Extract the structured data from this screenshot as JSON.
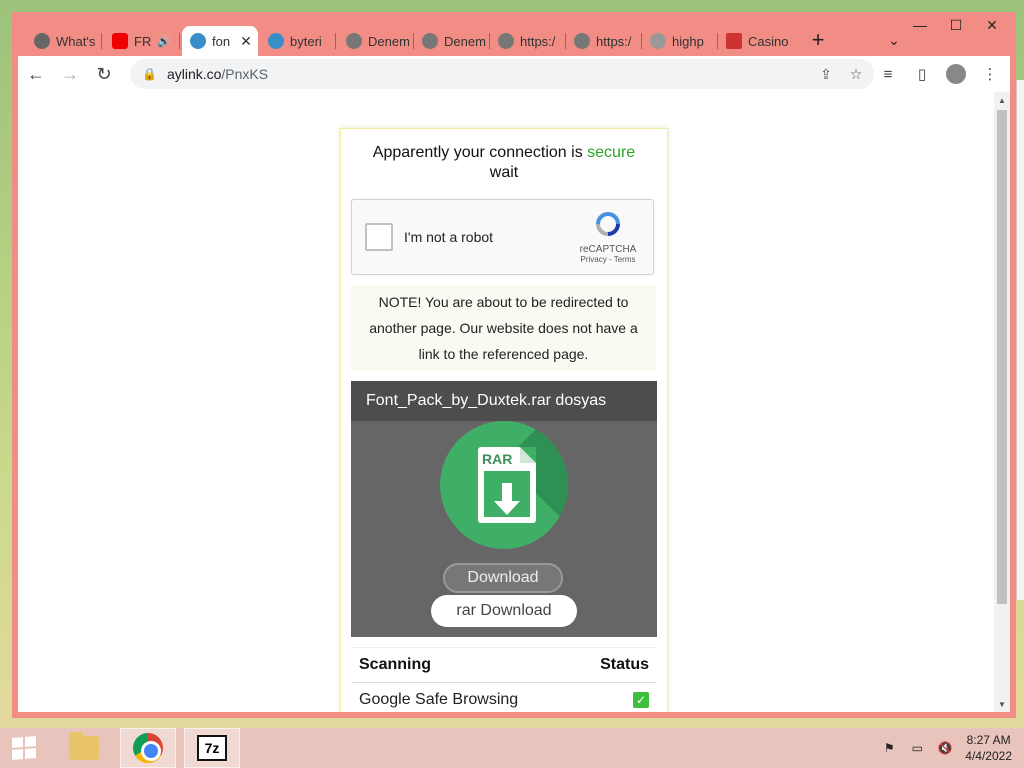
{
  "browser": {
    "tabs": [
      {
        "label": "What's",
        "fav": "#666"
      },
      {
        "label": "FR",
        "fav": "#e00"
      },
      {
        "label": "fon",
        "fav": "#3a8ec8"
      },
      {
        "label": "byteri",
        "fav": "#3a8ec8"
      },
      {
        "label": "Denem",
        "fav": "#777"
      },
      {
        "label": "Denem",
        "fav": "#777"
      },
      {
        "label": "https:/",
        "fav": "#777"
      },
      {
        "label": "https:/",
        "fav": "#777"
      },
      {
        "label": "highp",
        "fav": "#777"
      },
      {
        "label": "Casino",
        "fav": "#c33"
      }
    ],
    "url_host": "aylink.co",
    "url_path": "/PnxKS"
  },
  "page": {
    "headline_prefix": "Apparently your connection is",
    "headline_secure": "secure",
    "headline_wait": "wait",
    "recaptcha": {
      "label": "I'm not a robot",
      "brand": "reCAPTCHA",
      "links": "Privacy - Terms"
    },
    "note": "NOTE! You are about to be redirected to another page. Our website does not have a link to the referenced page.",
    "download": {
      "title": "Font_Pack_by_Duxtek.rar dosyas",
      "icon_text": "RAR",
      "button1": "Download",
      "button2": "rar Download"
    },
    "scan": {
      "col1": "Scanning",
      "col2": "Status",
      "rows": [
        {
          "name": "Google Safe Browsing",
          "status": "✓"
        }
      ]
    }
  },
  "taskbar": {
    "time": "8:27 AM",
    "date": "4/4/2022"
  },
  "colors": {
    "secure": "#2aa52a",
    "rar_green": "#3faf68",
    "frame": "#f28d86"
  }
}
